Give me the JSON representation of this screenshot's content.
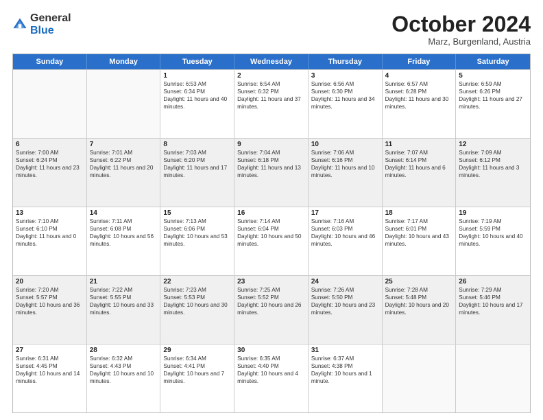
{
  "logo": {
    "general": "General",
    "blue": "Blue"
  },
  "header": {
    "month": "October 2024",
    "location": "Marz, Burgenland, Austria"
  },
  "weekdays": [
    "Sunday",
    "Monday",
    "Tuesday",
    "Wednesday",
    "Thursday",
    "Friday",
    "Saturday"
  ],
  "rows": [
    [
      {
        "day": "",
        "text": "",
        "empty": true
      },
      {
        "day": "",
        "text": "",
        "empty": true
      },
      {
        "day": "1",
        "text": "Sunrise: 6:53 AM\nSunset: 6:34 PM\nDaylight: 11 hours and 40 minutes."
      },
      {
        "day": "2",
        "text": "Sunrise: 6:54 AM\nSunset: 6:32 PM\nDaylight: 11 hours and 37 minutes."
      },
      {
        "day": "3",
        "text": "Sunrise: 6:56 AM\nSunset: 6:30 PM\nDaylight: 11 hours and 34 minutes."
      },
      {
        "day": "4",
        "text": "Sunrise: 6:57 AM\nSunset: 6:28 PM\nDaylight: 11 hours and 30 minutes."
      },
      {
        "day": "5",
        "text": "Sunrise: 6:59 AM\nSunset: 6:26 PM\nDaylight: 11 hours and 27 minutes."
      }
    ],
    [
      {
        "day": "6",
        "text": "Sunrise: 7:00 AM\nSunset: 6:24 PM\nDaylight: 11 hours and 23 minutes.",
        "alt": true
      },
      {
        "day": "7",
        "text": "Sunrise: 7:01 AM\nSunset: 6:22 PM\nDaylight: 11 hours and 20 minutes.",
        "alt": true
      },
      {
        "day": "8",
        "text": "Sunrise: 7:03 AM\nSunset: 6:20 PM\nDaylight: 11 hours and 17 minutes.",
        "alt": true
      },
      {
        "day": "9",
        "text": "Sunrise: 7:04 AM\nSunset: 6:18 PM\nDaylight: 11 hours and 13 minutes.",
        "alt": true
      },
      {
        "day": "10",
        "text": "Sunrise: 7:06 AM\nSunset: 6:16 PM\nDaylight: 11 hours and 10 minutes.",
        "alt": true
      },
      {
        "day": "11",
        "text": "Sunrise: 7:07 AM\nSunset: 6:14 PM\nDaylight: 11 hours and 6 minutes.",
        "alt": true
      },
      {
        "day": "12",
        "text": "Sunrise: 7:09 AM\nSunset: 6:12 PM\nDaylight: 11 hours and 3 minutes.",
        "alt": true
      }
    ],
    [
      {
        "day": "13",
        "text": "Sunrise: 7:10 AM\nSunset: 6:10 PM\nDaylight: 11 hours and 0 minutes."
      },
      {
        "day": "14",
        "text": "Sunrise: 7:11 AM\nSunset: 6:08 PM\nDaylight: 10 hours and 56 minutes."
      },
      {
        "day": "15",
        "text": "Sunrise: 7:13 AM\nSunset: 6:06 PM\nDaylight: 10 hours and 53 minutes."
      },
      {
        "day": "16",
        "text": "Sunrise: 7:14 AM\nSunset: 6:04 PM\nDaylight: 10 hours and 50 minutes."
      },
      {
        "day": "17",
        "text": "Sunrise: 7:16 AM\nSunset: 6:03 PM\nDaylight: 10 hours and 46 minutes."
      },
      {
        "day": "18",
        "text": "Sunrise: 7:17 AM\nSunset: 6:01 PM\nDaylight: 10 hours and 43 minutes."
      },
      {
        "day": "19",
        "text": "Sunrise: 7:19 AM\nSunset: 5:59 PM\nDaylight: 10 hours and 40 minutes."
      }
    ],
    [
      {
        "day": "20",
        "text": "Sunrise: 7:20 AM\nSunset: 5:57 PM\nDaylight: 10 hours and 36 minutes.",
        "alt": true
      },
      {
        "day": "21",
        "text": "Sunrise: 7:22 AM\nSunset: 5:55 PM\nDaylight: 10 hours and 33 minutes.",
        "alt": true
      },
      {
        "day": "22",
        "text": "Sunrise: 7:23 AM\nSunset: 5:53 PM\nDaylight: 10 hours and 30 minutes.",
        "alt": true
      },
      {
        "day": "23",
        "text": "Sunrise: 7:25 AM\nSunset: 5:52 PM\nDaylight: 10 hours and 26 minutes.",
        "alt": true
      },
      {
        "day": "24",
        "text": "Sunrise: 7:26 AM\nSunset: 5:50 PM\nDaylight: 10 hours and 23 minutes.",
        "alt": true
      },
      {
        "day": "25",
        "text": "Sunrise: 7:28 AM\nSunset: 5:48 PM\nDaylight: 10 hours and 20 minutes.",
        "alt": true
      },
      {
        "day": "26",
        "text": "Sunrise: 7:29 AM\nSunset: 5:46 PM\nDaylight: 10 hours and 17 minutes.",
        "alt": true
      }
    ],
    [
      {
        "day": "27",
        "text": "Sunrise: 6:31 AM\nSunset: 4:45 PM\nDaylight: 10 hours and 14 minutes."
      },
      {
        "day": "28",
        "text": "Sunrise: 6:32 AM\nSunset: 4:43 PM\nDaylight: 10 hours and 10 minutes."
      },
      {
        "day": "29",
        "text": "Sunrise: 6:34 AM\nSunset: 4:41 PM\nDaylight: 10 hours and 7 minutes."
      },
      {
        "day": "30",
        "text": "Sunrise: 6:35 AM\nSunset: 4:40 PM\nDaylight: 10 hours and 4 minutes."
      },
      {
        "day": "31",
        "text": "Sunrise: 6:37 AM\nSunset: 4:38 PM\nDaylight: 10 hours and 1 minute."
      },
      {
        "day": "",
        "text": "",
        "empty": true
      },
      {
        "day": "",
        "text": "",
        "empty": true
      }
    ]
  ]
}
